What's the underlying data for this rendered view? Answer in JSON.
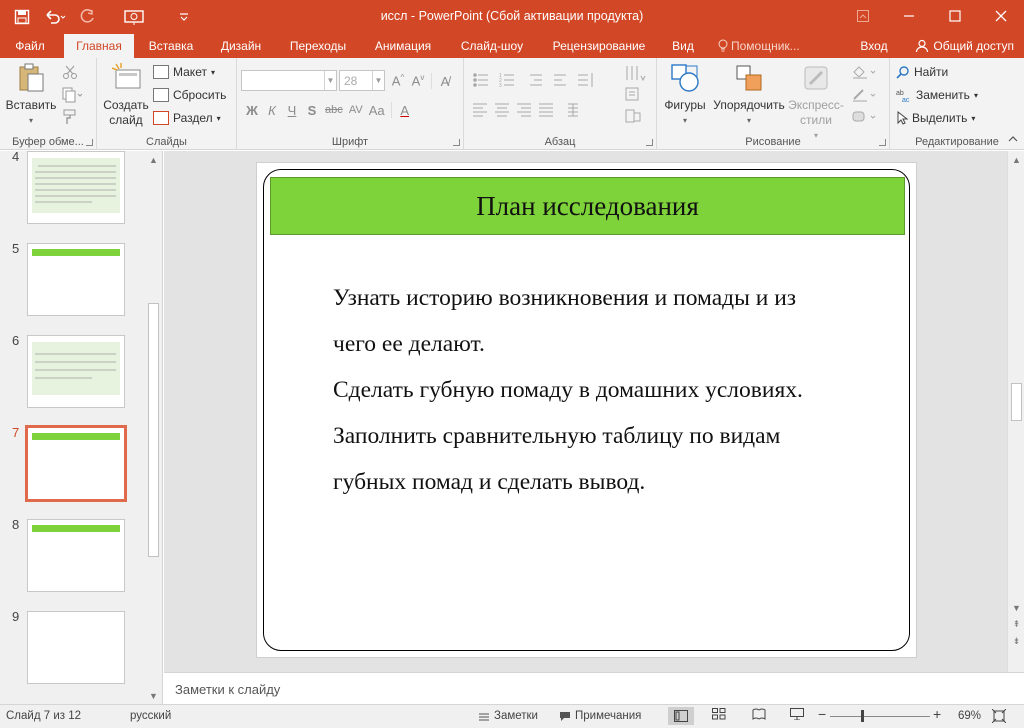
{
  "window": {
    "title": "иссл - PowerPoint (Сбой активации продукта)",
    "accent": "#d24726"
  },
  "qat": [
    "save-icon",
    "undo-icon",
    "redo-icon",
    "present-icon",
    "customize-icon"
  ],
  "tabs": [
    {
      "label": "Файл"
    },
    {
      "label": "Главная"
    },
    {
      "label": "Вставка"
    },
    {
      "label": "Дизайн"
    },
    {
      "label": "Переходы"
    },
    {
      "label": "Анимация"
    },
    {
      "label": "Слайд-шоу"
    },
    {
      "label": "Рецензирование"
    },
    {
      "label": "Вид"
    },
    {
      "label": "Помощник..."
    },
    {
      "label": "Вход"
    }
  ],
  "share_label": "Общий доступ",
  "ribbon": {
    "clipboard": {
      "label": "Буфер обме...",
      "paste": "Вставить"
    },
    "slides": {
      "label": "Слайды",
      "new_slide": "Создать слайд",
      "layout": "Макет",
      "reset": "Сбросить",
      "section": "Раздел"
    },
    "font": {
      "label": "Шрифт",
      "font_name": "",
      "font_size": "28",
      "buttons": [
        "Ж",
        "К",
        "Ч",
        "S",
        "abc",
        "AV",
        "Aa",
        "A"
      ]
    },
    "paragraph": {
      "label": "Абзац"
    },
    "drawing": {
      "label": "Рисование",
      "shapes": "Фигуры",
      "arrange": "Упорядочить",
      "quick_styles": "Экспресс-стили"
    },
    "editing": {
      "label": "Редактирование",
      "find": "Найти",
      "replace": "Заменить",
      "select": "Выделить"
    }
  },
  "thumbnails": [
    {
      "number": "4",
      "selected": false
    },
    {
      "number": "5",
      "selected": false
    },
    {
      "number": "6",
      "selected": false
    },
    {
      "number": "7",
      "selected": true
    },
    {
      "number": "8",
      "selected": false
    },
    {
      "number": "9",
      "selected": false
    }
  ],
  "slide": {
    "title": "План исследования",
    "title_bg": "#7ed23a",
    "lines": [
      "Узнать историю возникновения и помады и из",
      "чего ее делают.",
      "Сделать губную помаду в домашних условиях.",
      "Заполнить сравнительную таблицу по видам",
      "губных помад и сделать вывод."
    ]
  },
  "notes_placeholder": "Заметки к слайду",
  "status": {
    "slide_counter": "Слайд 7 из 12",
    "language": "русский",
    "notes": "Заметки",
    "comments": "Примечания",
    "zoom": "69%"
  }
}
